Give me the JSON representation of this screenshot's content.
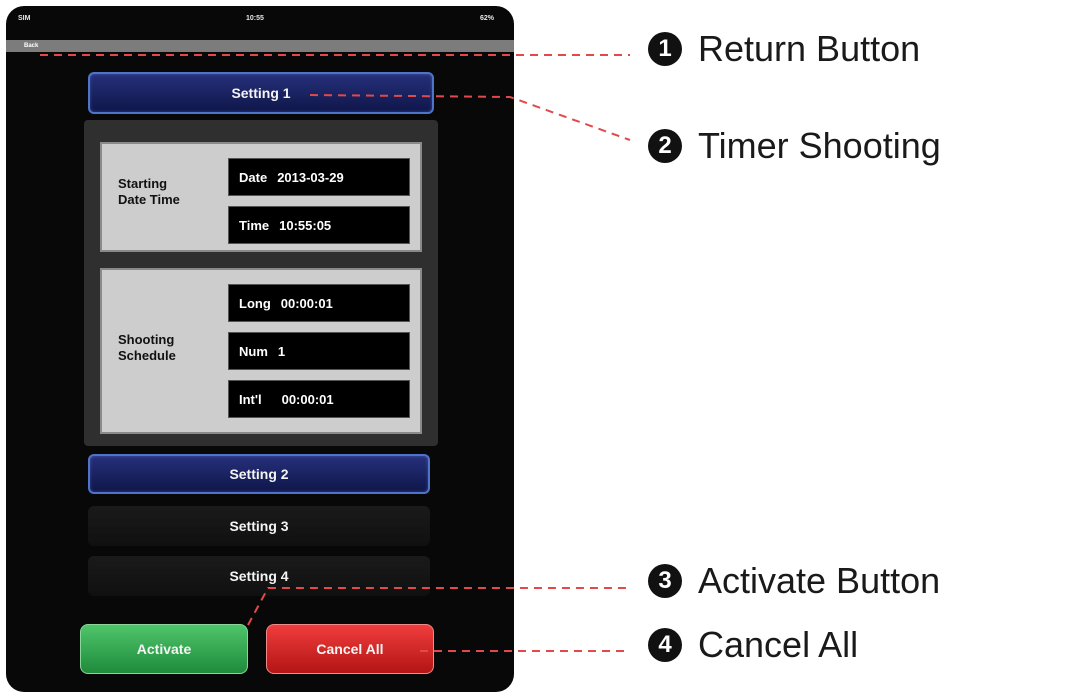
{
  "statusbar": {
    "carrier": "SIM",
    "time": "10:55",
    "battery": "62%"
  },
  "nav": {
    "back_label": "Back"
  },
  "settings": [
    {
      "label": "Setting 1"
    },
    {
      "label": "Setting 2"
    },
    {
      "label": "Setting 3"
    },
    {
      "label": "Setting 4"
    }
  ],
  "starting": {
    "label_line1": "Starting",
    "label_line2": "Date Time",
    "date_key": "Date",
    "date_value": "2013-03-29",
    "time_key": "Time",
    "time_value": "10:55:05"
  },
  "schedule": {
    "label_line1": "Shooting",
    "label_line2": "Schedule",
    "long_key": "Long",
    "long_value": "00:00:01",
    "num_key": "Num",
    "num_value": "1",
    "intl_key": "Int'l",
    "intl_value": "00:00:01"
  },
  "actions": {
    "activate_label": "Activate",
    "cancel_label": "Cancel All"
  },
  "callouts": [
    {
      "number": "1",
      "text": "Return Button"
    },
    {
      "number": "2",
      "text": "Timer Shooting"
    },
    {
      "number": "3",
      "text": "Activate Button"
    },
    {
      "number": "4",
      "text": "Cancel All"
    }
  ],
  "colors": {
    "active_setting": "#26307a",
    "activate": "#2fa84d",
    "cancel": "#d62222",
    "callout_line": "#e04a4a"
  }
}
